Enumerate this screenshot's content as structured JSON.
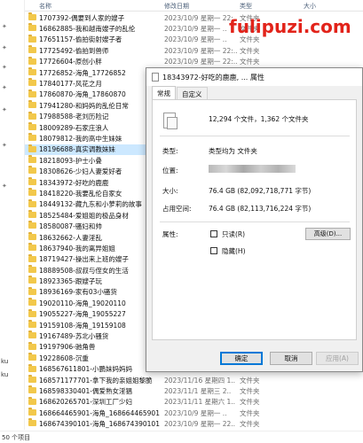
{
  "explorer": {
    "columns": {
      "name": "名称",
      "date": "修改日期",
      "type": "类型",
      "size": "大小"
    },
    "rows": [
      {
        "name": "1707392-偶要到人家的嫂子",
        "date": "2023/10/9 星期一 22:..",
        "type": "文件夹"
      },
      {
        "name": "16862885-我和越南嫂子的乱伦",
        "date": "2023/10/9 星期一 ..",
        "type": "文件夹"
      },
      {
        "name": "17651157-偷拍街射嫂子者",
        "date": "2023/10/9 星期一 ..",
        "type": "文件夹"
      },
      {
        "name": "17725492-偷拍到兽师",
        "date": "2023/10/9 星期一 22:..",
        "type": "文件夹"
      },
      {
        "name": "17726604-原创小胖",
        "date": "2023/10/9 星期一 22:..",
        "type": "文件夹"
      },
      {
        "name": "17726852-海角_17726852",
        "date": "",
        "type": ""
      },
      {
        "name": "17840177-风花之月",
        "date": "",
        "type": ""
      },
      {
        "name": "17860870-海角_17860870",
        "date": "",
        "type": ""
      },
      {
        "name": "17941280-和妈妈的乱伦日常",
        "date": "",
        "type": ""
      },
      {
        "name": "17988588-老刘历险记",
        "date": "",
        "type": ""
      },
      {
        "name": "18009289-石家庄浪人",
        "date": "",
        "type": ""
      },
      {
        "name": "18079812-我的高中生妹妹",
        "date": "",
        "type": ""
      },
      {
        "name": "18196688-真实调教妹妹",
        "date": "",
        "type": ""
      },
      {
        "name": "18218093-护士小叠",
        "date": "",
        "type": ""
      },
      {
        "name": "18308626-少妇人妻爱好者",
        "date": "",
        "type": ""
      },
      {
        "name": "18343972-好吃的鹿鹿",
        "date": "",
        "type": ""
      },
      {
        "name": "18418220-我要乱伦自家女",
        "date": "",
        "type": ""
      },
      {
        "name": "18449132-藏九东和小萝莉的故事",
        "date": "",
        "type": ""
      },
      {
        "name": "18525484-爱姐姐的极品身材",
        "date": "",
        "type": ""
      },
      {
        "name": "18580087-骚妇和帅",
        "date": "",
        "type": ""
      },
      {
        "name": "18632662-人妻淫乱",
        "date": "",
        "type": ""
      },
      {
        "name": "18637940-我的离异姐姐",
        "date": "",
        "type": ""
      },
      {
        "name": "18719427-操出来上班的嫂子",
        "date": "",
        "type": ""
      },
      {
        "name": "18889508-叔叔与侄女的生活",
        "date": "",
        "type": ""
      },
      {
        "name": "18923365-跟嫂子玩",
        "date": "",
        "type": ""
      },
      {
        "name": "18936169-家有03小骚货",
        "date": "",
        "type": ""
      },
      {
        "name": "19020110-海角_19020110",
        "date": "",
        "type": ""
      },
      {
        "name": "19055227-海角_19055227",
        "date": "",
        "type": ""
      },
      {
        "name": "19159108-海角_19159108",
        "date": "",
        "type": ""
      },
      {
        "name": "19167489-苏北小骚货",
        "date": "",
        "type": ""
      },
      {
        "name": "19197906-驰角兽",
        "date": "",
        "type": ""
      },
      {
        "name": "19228608-沉重",
        "date": "",
        "type": ""
      },
      {
        "name": "168567611801-小鹏妹妈妈妈",
        "date": "2023/11/21 星期二 20:..",
        "type": "文件夹"
      },
      {
        "name": "168571177701-拿下我的亲姐姐黎脆",
        "date": "2023/11/16 星期四 1..",
        "type": "文件夹"
      },
      {
        "name": "168598330401-偶爱熟女淫猖",
        "date": "2023/11/1 星期三 2..",
        "type": "文件夹"
      },
      {
        "name": "168620265701-深圳工厂少妇",
        "date": "2023/11/11 星期六 1..",
        "type": "文件夹"
      },
      {
        "name": "168664465901-海角_168664465901",
        "date": "2023/10/9 星期一 ..",
        "type": "文件夹"
      },
      {
        "name": "168674390101-海角_168674390101",
        "date": "2023/10/9 星期一 22..",
        "type": "文件夹"
      }
    ],
    "left_labels": [
      "ku",
      "ku"
    ],
    "status": "50 个项目"
  },
  "watermark": "fulipuzi.com",
  "dialog": {
    "title": "18343972-好吃的鹿鹿, ... 属性",
    "tabs": [
      "常规",
      "自定义"
    ],
    "summary": "12,294 个文件，1,362 个文件夹",
    "type_label": "类型:",
    "type_value": "类型均为 文件夹",
    "location_label": "位置:",
    "size_label": "大小:",
    "size_value": "76.4 GB (82,092,718,771 字节)",
    "disk_label": "占用空间:",
    "disk_value": "76.4 GB (82,113,716,224 字节)",
    "attributes_label": "属性:",
    "readonly_label": "只读(R)",
    "hidden_label": "隐藏(H)",
    "advanced_label": "高级(D)...",
    "ok_label": "确定",
    "cancel_label": "取消",
    "apply_label": "应用(A)"
  },
  "colors": {
    "selection": "#cce8ff",
    "folder": "#f2c84b",
    "watermark": "#e2231a",
    "accent": "#0078d7"
  }
}
